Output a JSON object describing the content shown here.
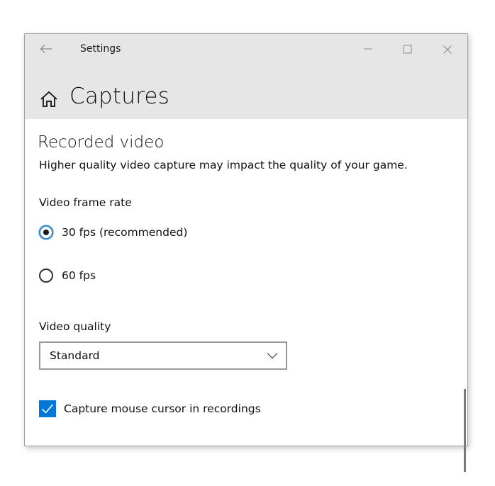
{
  "window": {
    "app_title": "Settings",
    "controls": {
      "back": "back-arrow-icon",
      "minimize": "minimize-icon",
      "maximize": "maximize-icon",
      "close": "close-icon"
    }
  },
  "page": {
    "icon": "home-icon",
    "title": "Captures"
  },
  "section": {
    "title": "Recorded video",
    "description": "Higher quality video capture may impact the quality of your game."
  },
  "frame_rate": {
    "label": "Video frame rate",
    "options": [
      {
        "label": "30 fps (recommended)",
        "selected": true
      },
      {
        "label": "60 fps",
        "selected": false
      }
    ]
  },
  "quality": {
    "label": "Video quality",
    "selected": "Standard",
    "icon": "chevron-down-icon"
  },
  "capture_cursor": {
    "label": "Capture mouse cursor in recordings",
    "checked": true
  },
  "colors": {
    "accent": "#0078d7",
    "header_bg": "#e6e6e6",
    "radio_ring": "#2e86c1"
  }
}
